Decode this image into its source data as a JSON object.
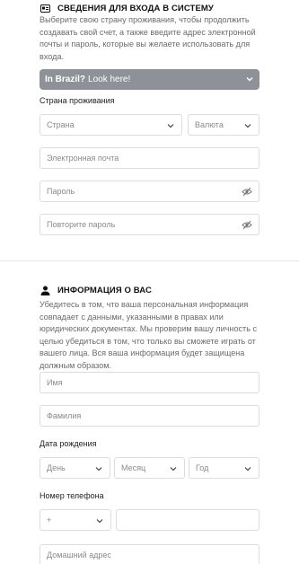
{
  "login_section": {
    "title": "СВЕДЕНИЯ ДЛЯ ВХОДА В СИСТЕМУ",
    "icon": "id-card-icon",
    "description": "Выберите свою страну проживания, чтобы продолжить создавать свой счет, а также введите адрес электронной почты и пароль, которые вы желаете использовать для входа.",
    "banner": {
      "bold": "In Brazil?",
      "text": "Look here!",
      "color": "#8e9198"
    },
    "residence_label": "Страна проживания",
    "country_placeholder": "Страна",
    "currency_placeholder": "Валюта",
    "email_placeholder": "Электронная почта",
    "password_placeholder": "Пароль",
    "repeat_password_placeholder": "Повторите пароль"
  },
  "personal_section": {
    "title": "ИНФОРМАЦИЯ О ВАС",
    "icon": "user-icon",
    "description": "Убедитесь в том, что ваша персональная информация совпадает с данными, указанными в правах или юридических документах. Мы проверим вашу личность с целью убедиться в том, что только вы сможете играть от вашего лица. Вся ваша информация будет защищена должным образом.",
    "first_name_placeholder": "Имя",
    "last_name_placeholder": "Фамилия",
    "birthdate_label": "Дата рождения",
    "day_placeholder": "День",
    "month_placeholder": "Месяц",
    "year_placeholder": "Год",
    "phone_label": "Номер телефона",
    "phone_prefix": "+",
    "phone_value": "",
    "address_placeholder": "Домашний адрес"
  }
}
